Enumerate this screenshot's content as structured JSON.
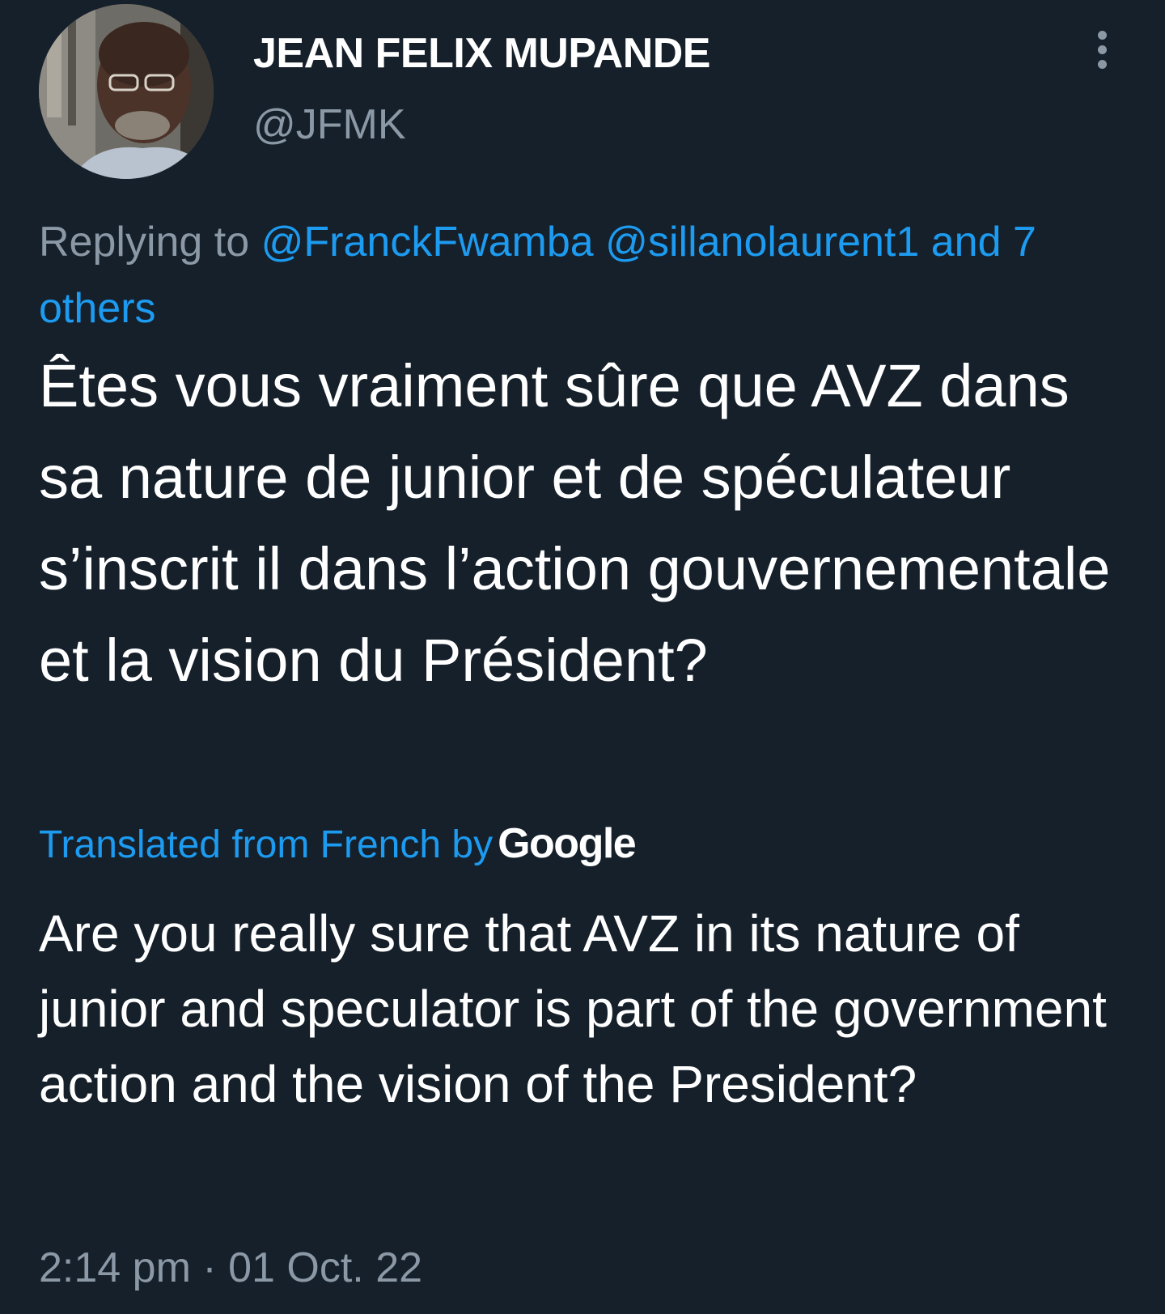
{
  "author": {
    "display_name": "JEAN FELIX MUPANDE",
    "handle": "@JFMK"
  },
  "reply": {
    "prefix": "Replying to",
    "mentions": [
      "@FranckFwamba",
      "@sillanolaurent1"
    ],
    "and_word": "and",
    "others": "7 others"
  },
  "tweet": {
    "text": "Êtes vous vraiment sûre que AVZ dans sa nature de junior et de spéculateur s’inscrit il dans l’action gouvernementale et la vision du Président?"
  },
  "translation": {
    "label": "Translated from French by",
    "provider": "Google",
    "text": "Are you really sure that AVZ in its nature of junior and speculator is part of the government action and the vision of the President?"
  },
  "meta": {
    "time": "2:14 pm",
    "separator": "·",
    "date": "01 Oct. 22"
  },
  "colors": {
    "background": "#15202b",
    "primary_text": "#ffffff",
    "secondary_text": "#8b98a5",
    "link": "#1d9bf0"
  },
  "icons": {
    "more": "more-vertical-icon"
  }
}
